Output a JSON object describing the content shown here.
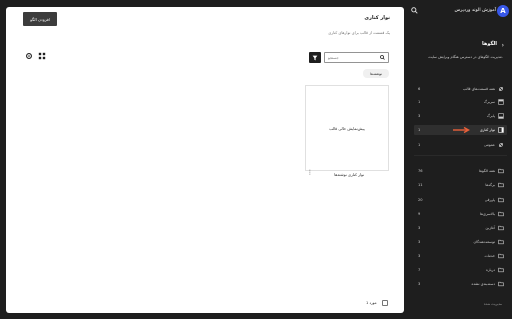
{
  "main": {
    "title": "نوار کناری",
    "subtitle": "یک قسمت از قالب برای نوارهای کناری",
    "add_pattern_label": "افزودن الگو",
    "search_placeholder": "جستجو",
    "filter_chip": "نوشته‌ها",
    "card_preview_text": "پیش‌نمایش خالی قالب",
    "card_caption": "نوار کناری نوشته‌ها",
    "footer_count": "1 مورد"
  },
  "sidebar": {
    "site_name": "آموزش الوند وردپرس",
    "logo_letter": "A",
    "heading": "الگوها",
    "description": "مدیریت الگوهای در دسترس هنگام ویرایش سایت.",
    "template_parts": [
      {
        "label": "همه قسمت‌های قالب",
        "count": "6",
        "icon": "template-parts-icon"
      },
      {
        "label": "سربرگ",
        "count": "1",
        "icon": "header-icon"
      },
      {
        "label": "پابرگ",
        "count": "3",
        "icon": "footer-icon"
      },
      {
        "label": "نوار کناری",
        "count": "1",
        "icon": "sidebar-icon",
        "active": true
      },
      {
        "label": "عمومی",
        "count": "1",
        "icon": "general-icon"
      }
    ],
    "categories": [
      {
        "label": "همه الگوها",
        "count": "76"
      },
      {
        "label": "برگه‌ها",
        "count": "11"
      },
      {
        "label": "پاورقی",
        "count": "20"
      },
      {
        "label": "بالاسری‌ها",
        "count": "9"
      },
      {
        "label": "آغازین",
        "count": "3"
      },
      {
        "label": "توسعه‌دهندگان",
        "count": "3"
      },
      {
        "label": "خدمات",
        "count": "3"
      },
      {
        "label": "درباره",
        "count": "7"
      },
      {
        "label": "دسته‌بندی نشده",
        "count": "3"
      }
    ],
    "manage_label": "مدیریت شده"
  }
}
